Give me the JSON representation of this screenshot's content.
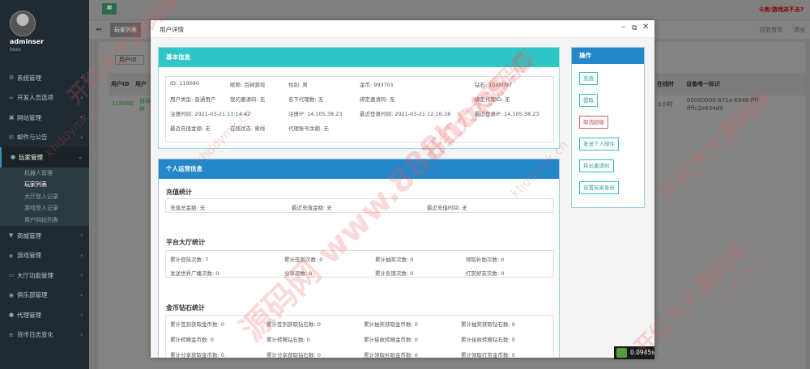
{
  "user": {
    "name": "adminser",
    "role": "boss"
  },
  "sidebar": {
    "items": [
      {
        "label": "系统管理",
        "icon": "cogs-icon",
        "sym": "⚙"
      },
      {
        "label": "开发人员选项",
        "icon": "link-icon",
        "sym": "∞"
      },
      {
        "label": "网站管理",
        "icon": "briefcase-icon",
        "sym": "▣"
      },
      {
        "label": "邮件与公告",
        "icon": "envelope-icon",
        "sym": "✉"
      },
      {
        "label": "玩家管理",
        "icon": "user-icon",
        "sym": "●"
      }
    ],
    "subs": [
      "机器人管理",
      "玩家列表",
      "大厅登入记录",
      "游戏登入记录",
      "用户购钻列表"
    ],
    "items2": [
      {
        "label": "商城管理",
        "icon": "cart-icon",
        "sym": "▼"
      },
      {
        "label": "游戏管理",
        "icon": "gamepad-icon",
        "sym": "◈"
      },
      {
        "label": "大厅功能管理",
        "icon": "desktop-icon",
        "sym": "▭"
      },
      {
        "label": "俱乐部管理",
        "icon": "users-icon",
        "sym": "◉"
      },
      {
        "label": "代理管理",
        "icon": "agent-icon",
        "sym": "●"
      },
      {
        "label": "货币日志变化",
        "icon": "list-icon",
        "sym": "≡"
      }
    ]
  },
  "topbar": {
    "menu_icon": "≡",
    "notice": "卡房/游戏进不去?"
  },
  "tabs": {
    "player_tab": "玩家列表",
    "prev": "◂◂",
    "close_others": "回到首页",
    "exit": "退出"
  },
  "table": {
    "filter_label": "用户ID",
    "headers": [
      "用户ID",
      "用户",
      "在线时",
      "设备唯一标识"
    ],
    "row": {
      "id": "119080",
      "nick_part1": "百钟",
      "nick_part2": "祥",
      "online": "1小时",
      "device_1": "00000000-671a-6948-ffff-",
      "device_2": "ffffc2e634d9"
    }
  },
  "modal": {
    "title": "用户详情",
    "basic": {
      "title": "基本信息",
      "rows": [
        [
          "ID: 119080",
          "昵称: 百钟游戏",
          "性别: 男",
          "金币: 993701",
          "钻石: 1000097"
        ],
        [
          "用户类型: 普通用户",
          "我的邀请码: 无",
          "名下代理数: 无",
          "绑定邀请码: 无",
          "绑定代理ID: 无"
        ],
        [
          "注册时间: 2021-03-21 11:14:42",
          "注册IP: 14.105.38.23",
          "最近登录时间: 2021-03-21 12:16:28",
          "最近登录IP: 14.105.38.23"
        ],
        [
          "最近充值金额: 无",
          "在线状态: 离线",
          "代理账号余额: 无"
        ]
      ]
    },
    "stats": {
      "title": "个人运营信息",
      "recharge": {
        "title": "充值统计",
        "cells": [
          "充值总金额: 无",
          "最近充值金额: 无",
          "最近充值时间: 无"
        ]
      },
      "hall": {
        "title": "平台大厅统计",
        "cells": [
          "累计登陆次数: 7",
          "累计签到次数: 0",
          "累计抽奖次数: 0",
          "领取补助次数: 0",
          "发送世界广播次数: 0",
          "分享次数: 0",
          "累计反馈次数: 0",
          "打赏好友次数: 0"
        ]
      },
      "gold": {
        "title": "金币钻石统计",
        "cells": [
          "累计签到获取金币数: 0",
          "累计签到获取钻石数: 0",
          "累计抽奖获取金币数: 0",
          "累计抽奖获取钻石数: 0",
          "累计转赠金币数: 0",
          "累计转赠钻石数: 0",
          "累计接收转赠金币数: 0",
          "累计接收转赠钻石数: 0",
          "累计分享获取金币数: 0",
          "累计分享获取钻石数: 0",
          "累计领取补助金币数: 0",
          "累计领取打赏金币数: 0"
        ]
      }
    },
    "ops": {
      "title": "操作",
      "buttons": [
        "充值",
        "提取",
        "取消超级",
        "发送个人邮件",
        "将出邀请码",
        "设置玩家身份"
      ]
    }
  },
  "timer": "0.0945s",
  "watermarks": [
    "开红大大源码库",
    "khddymk.cn",
    "源码网 www.888hops.c",
    "khddymk.cn",
    "开红大大源码库",
    "khddymk.cn",
    "开红大大源码库",
    "开红大大源码库",
    "khddymk.cn"
  ]
}
